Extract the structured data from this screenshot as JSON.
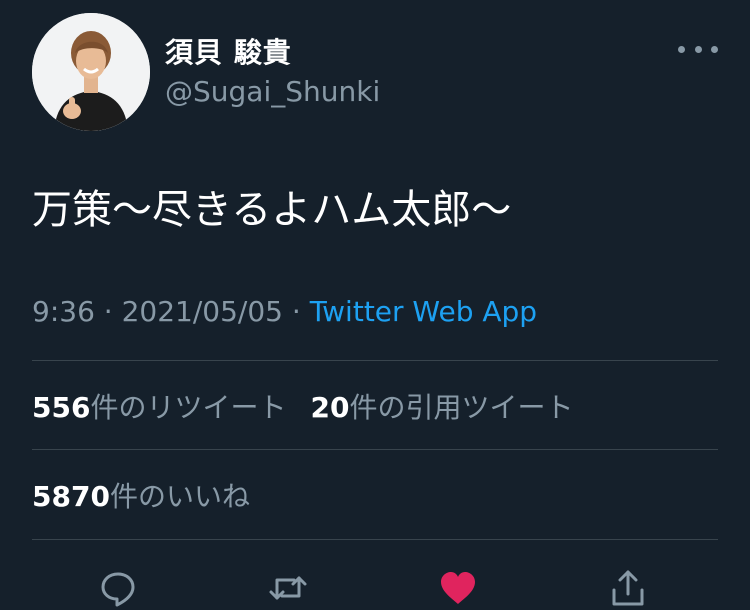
{
  "user": {
    "display_name": "須貝 駿貴",
    "handle": "@Sugai_Shunki",
    "avatar_icon": "person-avatar-icon"
  },
  "tweet": {
    "text": "万策〜尽きるよハム太郎〜",
    "time": "9:36",
    "separator": " · ",
    "date": "2021/05/05",
    "source": "Twitter Web App"
  },
  "stats": {
    "retweets": "556",
    "retweets_label": "件のリツイート",
    "quotes": "20",
    "quotes_label": "件の引用ツイート",
    "likes": "5870",
    "likes_label": "件のいいね"
  },
  "actions": [
    {
      "icon": "reply-icon"
    },
    {
      "icon": "retweet-icon"
    },
    {
      "icon": "heart-icon",
      "active": true,
      "color": "#e0245e"
    },
    {
      "icon": "share-icon"
    }
  ],
  "colors": {
    "background": "#15202b",
    "text_primary": "#ffffff",
    "text_secondary": "#8899a6",
    "link": "#1da1f2",
    "divider": "#38444d",
    "like": "#e0245e"
  }
}
